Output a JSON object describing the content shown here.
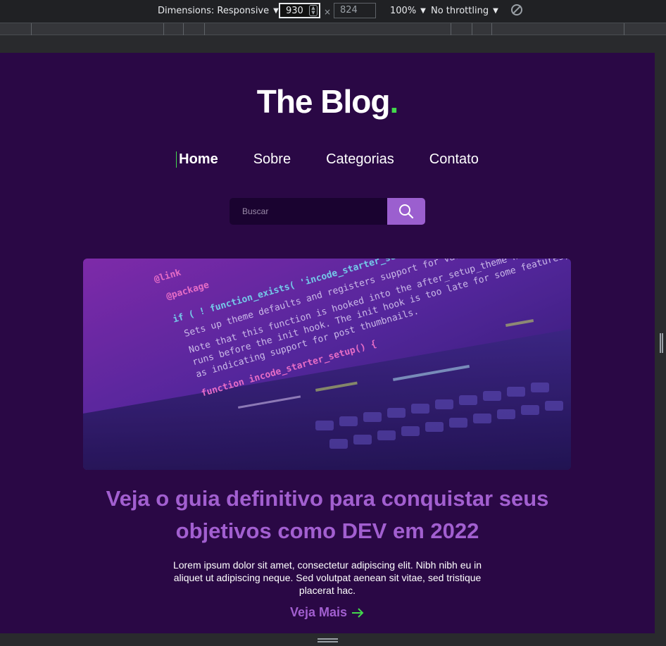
{
  "devtools": {
    "dimensions_label": "Dimensions: Responsive",
    "width_value": "930",
    "height_value": "824",
    "times_symbol": "×",
    "zoom_label": "100%",
    "throttling_label": "No throttling"
  },
  "site": {
    "logo_text": "The Blog",
    "logo_dot": ".",
    "colors": {
      "background": "#2a0845",
      "accent_green": "#43d94c",
      "accent_purple": "#a25fd0"
    },
    "nav": [
      {
        "label": "Home",
        "active": true
      },
      {
        "label": "Sobre"
      },
      {
        "label": "Categorias"
      },
      {
        "label": "Contato"
      }
    ],
    "search": {
      "placeholder": "Buscar",
      "icon": "search-icon"
    },
    "post": {
      "title": "Veja o guia definitivo para conquistar seus objetivos como DEV em 2022",
      "excerpt": "Lorem ipsum dolor sit amet, consectetur adipiscing elit. Nibh nibh eu in aliquet ut adipiscing neque. Sed volutpat aenean sit vitae, sed tristique placerat hac.",
      "read_more": "Veja Mais",
      "image_code_lines": [
        "@link",
        "@package",
        "if ( ! function_exists( 'incode_starter_setup' ) ) :",
        "Sets up theme defaults and registers support for various WordPress features.",
        "Note that this function is hooked into the after_setup_theme hook, which",
        "runs before the init hook. The init hook is too late for some features, such",
        "as indicating support for post thumbnails.",
        "function incode_starter_setup() {"
      ]
    }
  }
}
